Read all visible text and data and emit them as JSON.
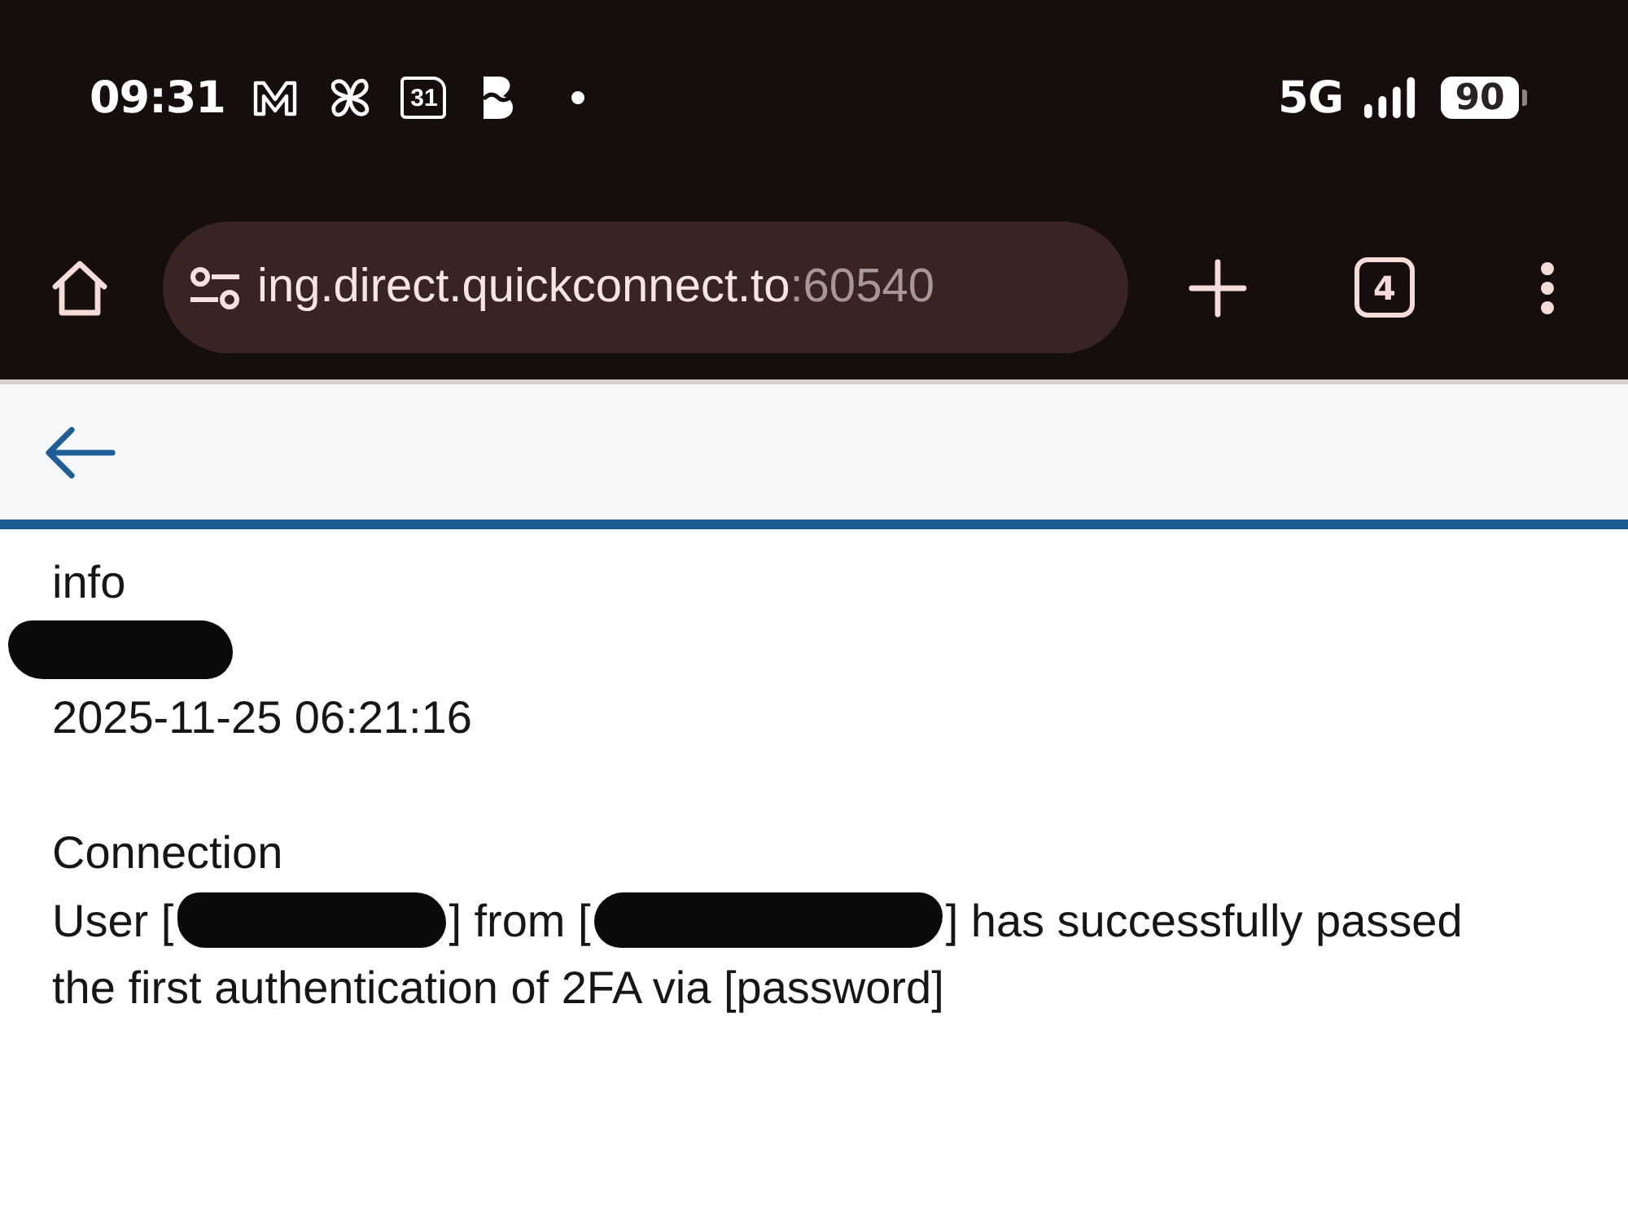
{
  "status_bar": {
    "time": "09:31",
    "calendar_date": "31",
    "network": "5G",
    "battery": "90"
  },
  "browser_toolbar": {
    "url_host": "ing.direct.quickconnect.to",
    "url_port": ":60540",
    "tab_count": "4"
  },
  "log_entry": {
    "lines": [
      {
        "kind": "level",
        "text": "info"
      },
      {
        "kind": "redacted"
      },
      {
        "kind": "timestamp",
        "text": "2025-11-25 06:21:16"
      },
      {
        "kind": "blank"
      },
      {
        "kind": "category",
        "text": "Connection"
      },
      {
        "kind": "message",
        "parts": [
          {
            "kind": "text",
            "text": "User ["
          },
          {
            "kind": "redacted"
          },
          {
            "kind": "text",
            "text": "] from ["
          },
          {
            "kind": "redacted"
          },
          {
            "kind": "text",
            "text": "] has successfully passed"
          },
          {
            "kind": "text",
            "text": "the first authentication of 2FA via [password]"
          }
        ]
      }
    ]
  }
}
